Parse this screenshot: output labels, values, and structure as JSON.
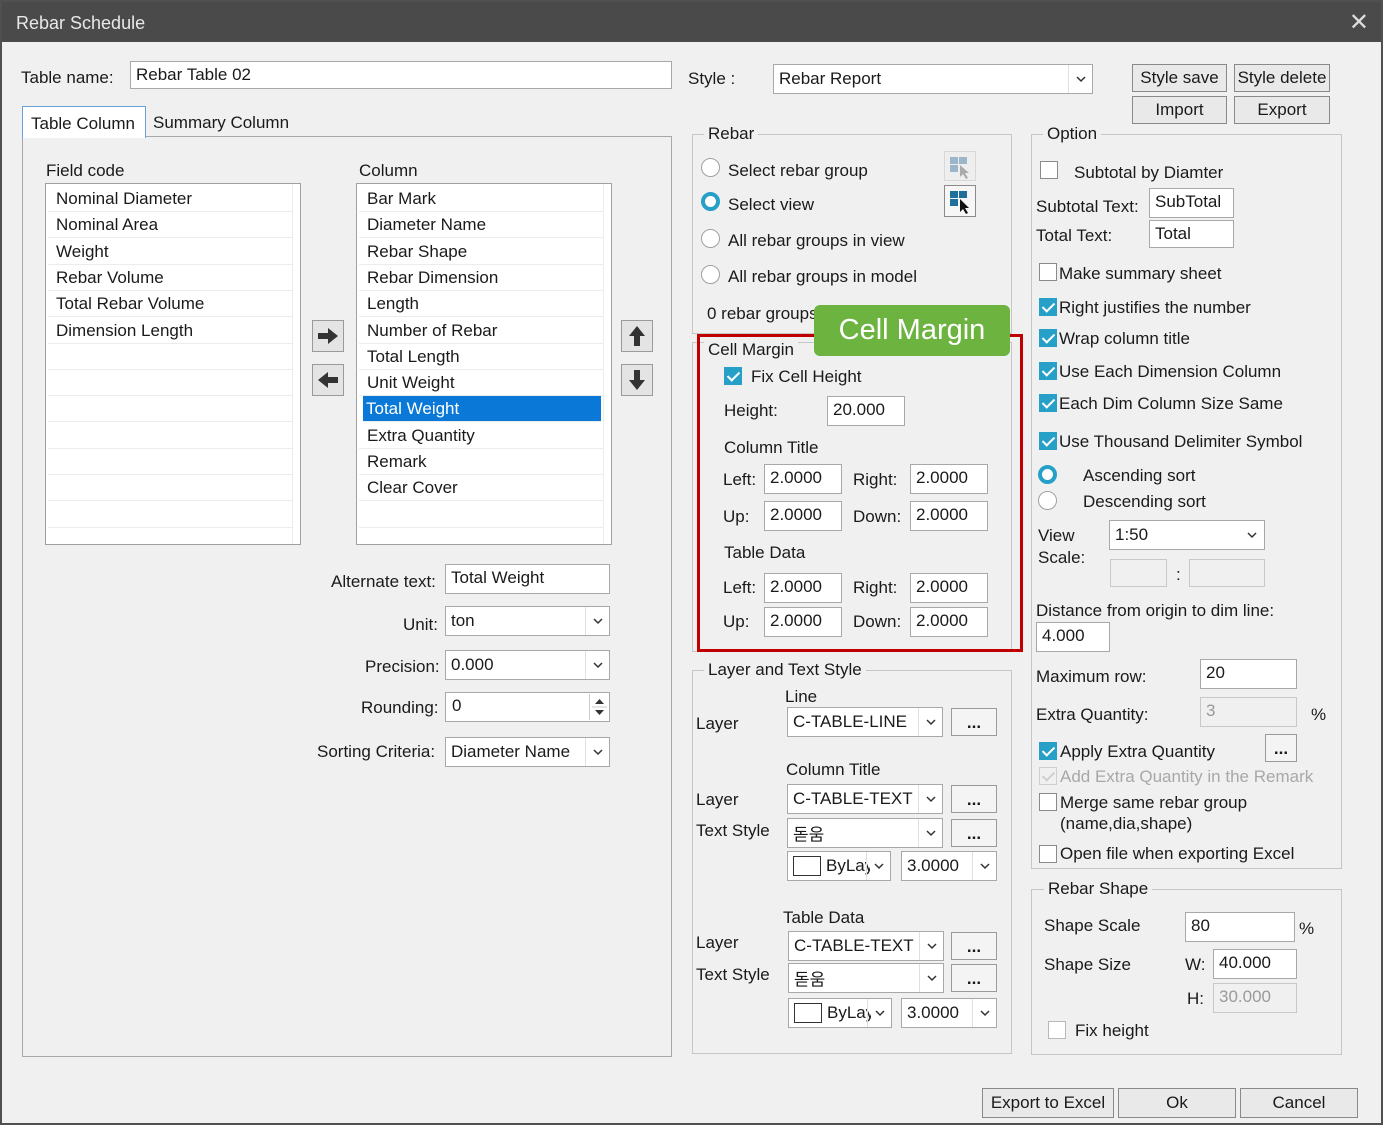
{
  "window": {
    "title": "Rebar Schedule",
    "close": "✕"
  },
  "table_name": {
    "label": "Table name:",
    "value": "Rebar Table 02"
  },
  "style": {
    "label": "Style :",
    "value": "Rebar Report",
    "save": "Style save",
    "delete": "Style delete",
    "import": "Import",
    "export": "Export"
  },
  "tabs": [
    {
      "label": "Table Column"
    },
    {
      "label": "Summary Column"
    }
  ],
  "field_code": {
    "label": "Field code",
    "items": [
      "Nominal Diameter",
      "Nominal Area",
      "Weight",
      "Rebar Volume",
      "Total Rebar Volume",
      "Dimension Length"
    ]
  },
  "column": {
    "label": "Column",
    "items": [
      "Bar Mark",
      "Diameter Name",
      "Rebar Shape",
      "Rebar Dimension",
      "Length",
      "Number of Rebar",
      "Total Length",
      "Unit Weight",
      "Total Weight",
      "Extra Quantity",
      "Remark",
      "Clear Cover"
    ],
    "selected": "Total Weight"
  },
  "props": {
    "alternate_text": {
      "label": "Alternate text:",
      "value": "Total Weight"
    },
    "unit": {
      "label": "Unit:",
      "value": "ton"
    },
    "precision": {
      "label": "Precision:",
      "value": "0.000"
    },
    "rounding": {
      "label": "Rounding:",
      "value": "0"
    },
    "sorting": {
      "label": "Sorting Criteria:",
      "value": "Diameter Name"
    }
  },
  "rebar": {
    "title": "Rebar",
    "options": [
      "Select rebar group",
      "Select view",
      "All rebar groups in view",
      "All rebar groups in model"
    ],
    "selected": "Select view",
    "count": "0 rebar groups"
  },
  "cell_margin": {
    "callout": "Cell Margin",
    "title": "Cell Margin",
    "fix_cell_height": "Fix Cell Height",
    "height_label": "Height:",
    "height": "20.000",
    "column_title": "Column Title",
    "table_data": "Table Data",
    "left_label": "Left:",
    "right_label": "Right:",
    "up_label": "Up:",
    "down_label": "Down:",
    "ct_left": "2.0000",
    "ct_right": "2.0000",
    "ct_up": "2.0000",
    "ct_down": "2.0000",
    "td_left": "2.0000",
    "td_right": "2.0000",
    "td_up": "2.0000",
    "td_down": "2.0000"
  },
  "layer_text": {
    "title": "Layer and Text Style",
    "line": "Line",
    "layer_label": "Layer",
    "text_style_label": "Text Style",
    "line_layer": "C-TABLE-LINE",
    "column_title": "Column Title",
    "ct_layer": "C-TABLE-TEXT",
    "ct_font": "돋움",
    "ct_color": "ByLayer",
    "ct_size": "3.0000",
    "table_data": "Table Data",
    "td_layer": "C-TABLE-TEXT",
    "td_font": "돋움",
    "td_color": "ByLayer",
    "td_size": "3.0000",
    "dots": "..."
  },
  "option": {
    "title": "Option",
    "subtotal_by_diameter": "Subtotal by Diamter",
    "subtotal_text_label": "Subtotal Text:",
    "subtotal_text": "SubTotal",
    "total_text_label": "Total Text:",
    "total_text": "Total",
    "make_summary": "Make summary sheet",
    "right_justify": "Right justifies the number",
    "wrap_title": "Wrap column title",
    "each_dim_col": "Use Each Dimension Column",
    "each_dim_same": "Each Dim Column Size Same",
    "thousand": "Use Thousand Delimiter Symbol",
    "ascending": "Ascending sort",
    "descending": "Descending sort",
    "view_scale_label_1": "View",
    "view_scale_label_2": "Scale:",
    "view_scale": "1:50",
    "colon": ":",
    "distance_label": "Distance from origin to dim line:",
    "distance": "4.000",
    "max_row_label": "Maximum row:",
    "max_row": "20",
    "extra_qty_label": "Extra Quantity:",
    "extra_qty": "3",
    "percent": "%",
    "apply_extra": "Apply Extra Quantity",
    "add_extra_remark": "Add Extra Quantity in the Remark",
    "merge_same": "Merge same rebar group",
    "merge_same_2": "(name,dia,shape)",
    "open_file": "Open file when exporting Excel"
  },
  "rebar_shape": {
    "title": "Rebar Shape",
    "scale_label": "Shape Scale",
    "scale": "80",
    "percent": "%",
    "size_label": "Shape Size",
    "w_label": "W:",
    "w": "40.000",
    "h_label": "H:",
    "h": "30.000",
    "fix_height": "Fix height"
  },
  "footer": {
    "export_excel": "Export to Excel",
    "ok": "Ok",
    "cancel": "Cancel"
  },
  "colors": {
    "accent": "#27a0c8",
    "selection": "#0a78d7",
    "callout_bg": "#6cb33f",
    "callout_border": "#c00000",
    "titlebar": "#4a4a4a"
  }
}
